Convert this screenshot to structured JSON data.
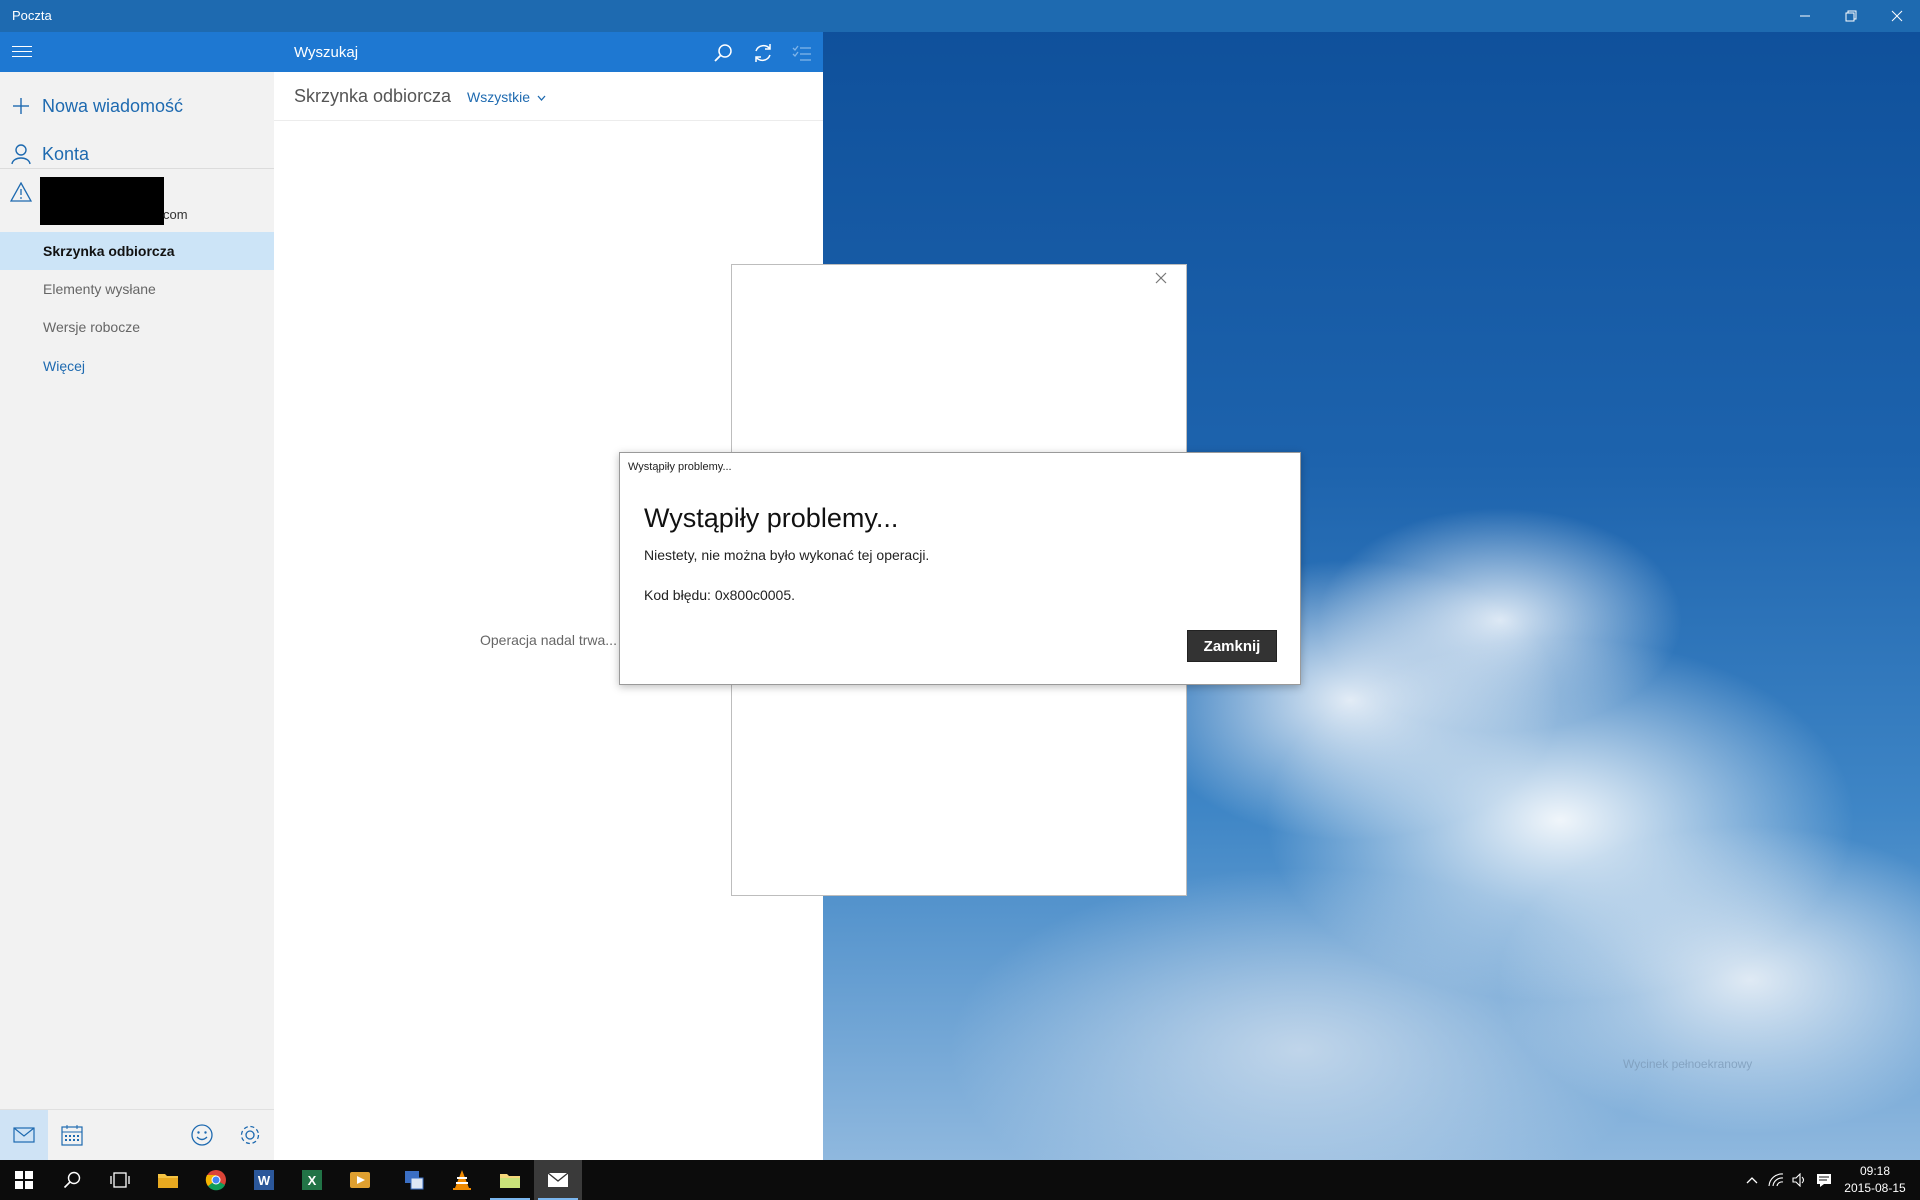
{
  "window": {
    "title": "Poczta"
  },
  "sidebar": {
    "new_message": "Nowa wiadomość",
    "accounts": "Konta",
    "account_suffix": "com",
    "folders": [
      {
        "label": "Skrzynka odbiorcza",
        "active": true
      },
      {
        "label": "Elementy wysłane",
        "active": false
      },
      {
        "label": "Wersje robocze",
        "active": false
      },
      {
        "label": "Więcej",
        "active": false
      }
    ]
  },
  "list": {
    "search_label": "Wyszukaj",
    "folder_title": "Skrzynka odbiorcza",
    "filter": "Wszystkie",
    "progress_text": "Operacja nadal trwa..."
  },
  "dialog": {
    "caption": "Wystąpiły problemy...",
    "heading": "Wystąpiły problemy...",
    "message": "Niestety, nie można było wykonać tej operacji.",
    "error_code": "Kod błędu: 0x800c0005.",
    "close_button": "Zamknij"
  },
  "desktop": {
    "watermark": "Wycinek pełnoekranowy"
  },
  "taskbar": {
    "time": "09:18",
    "date": "2015-08-15"
  },
  "colors": {
    "accent": "#1e78d2",
    "titlebar": "#1e6ab0",
    "selection": "#cce4f7"
  }
}
